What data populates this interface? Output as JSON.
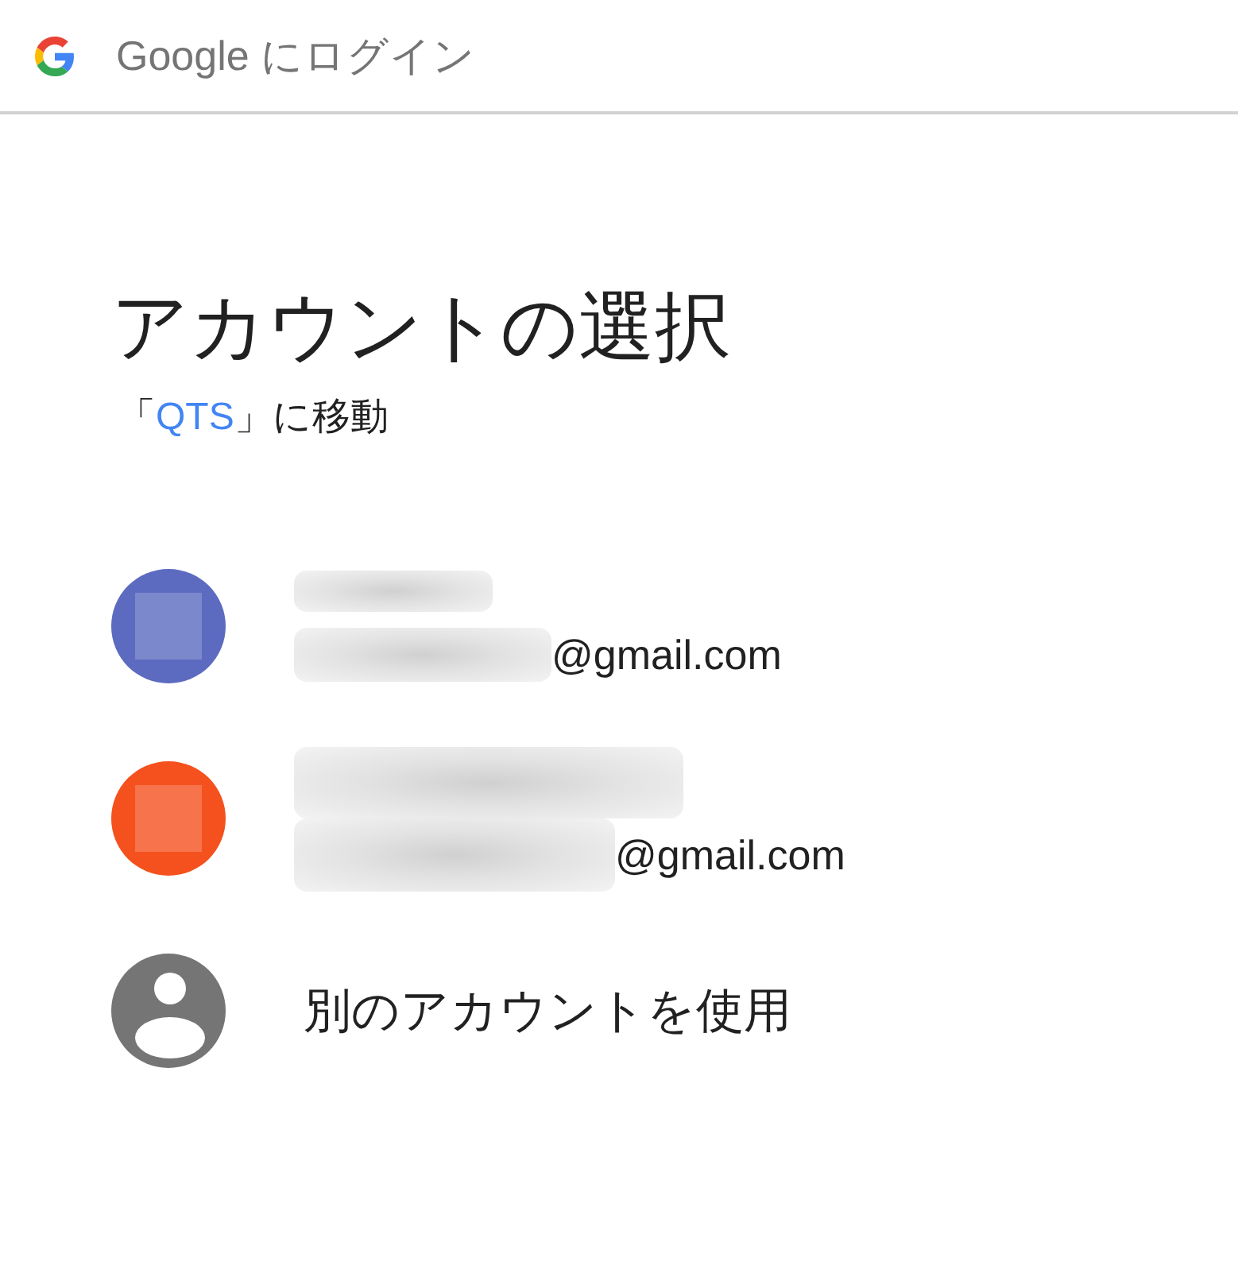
{
  "header": {
    "title": "Google にログイン"
  },
  "heading": "アカウントの選択",
  "subtitle": {
    "before": "「",
    "app_name": "QTS",
    "after": "」に移動"
  },
  "accounts": [
    {
      "color": "#5c6bc0",
      "email_domain": "@gmail.com"
    },
    {
      "color": "#f4511e",
      "email_domain": "@gmail.com"
    }
  ],
  "other_account": {
    "label": "別のアカウントを使用"
  }
}
